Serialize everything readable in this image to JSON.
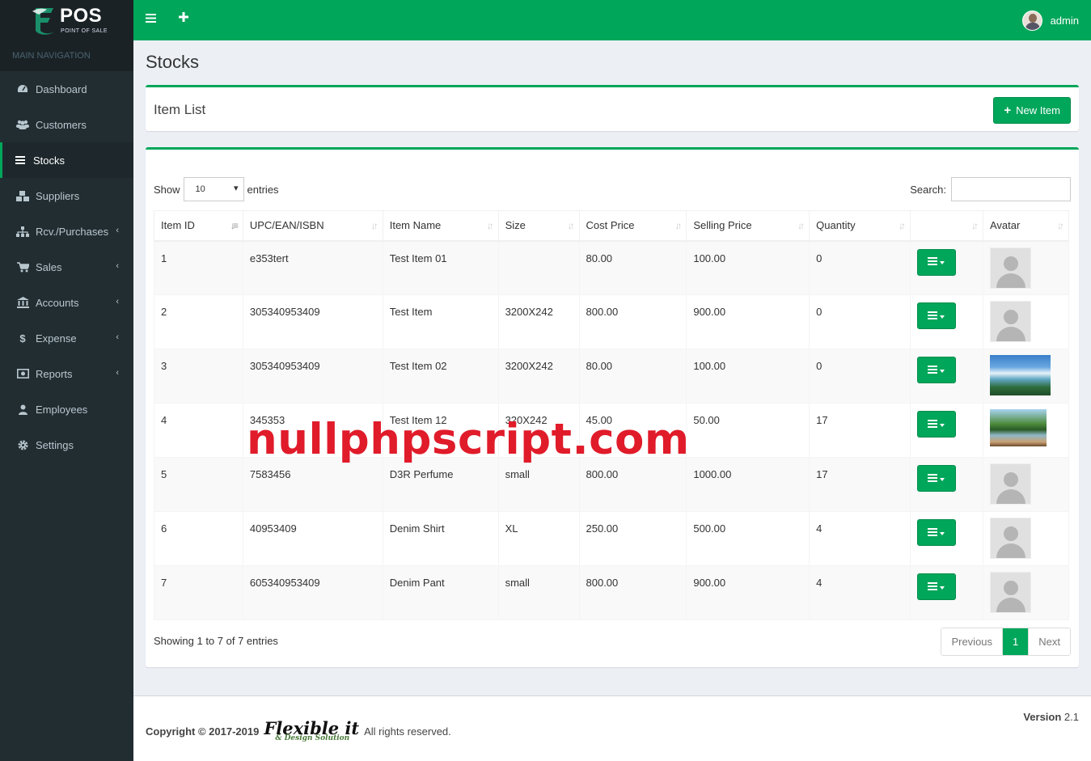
{
  "brand": {
    "name": "POS",
    "sub": "POINT OF SALE"
  },
  "sidebar": {
    "header": "MAIN NAVIGATION",
    "items": [
      {
        "label": "Dashboard",
        "icon": "dashboard-icon"
      },
      {
        "label": "Customers",
        "icon": "users-icon"
      },
      {
        "label": "Stocks",
        "icon": "list-icon"
      },
      {
        "label": "Suppliers",
        "icon": "cubes-icon"
      },
      {
        "label": "Rcv./Purchases",
        "icon": "sitemap-icon"
      },
      {
        "label": "Sales",
        "icon": "cart-icon"
      },
      {
        "label": "Accounts",
        "icon": "bank-icon"
      },
      {
        "label": "Expense",
        "icon": "dollar-icon"
      },
      {
        "label": "Reports",
        "icon": "report-icon"
      },
      {
        "label": "Employees",
        "icon": "user-icon"
      },
      {
        "label": "Settings",
        "icon": "gear-icon"
      }
    ]
  },
  "header": {
    "user": "admin"
  },
  "page": {
    "title": "Stocks"
  },
  "item_list": {
    "title": "Item List",
    "new_button": "New Item"
  },
  "table_controls": {
    "show": "Show",
    "length": "10",
    "entries": "entries",
    "search": "Search:"
  },
  "table": {
    "headers": [
      "Item ID",
      "UPC/EAN/ISBN",
      "Item Name",
      "Size",
      "Cost Price",
      "Selling Price",
      "Quantity",
      "",
      "Avatar"
    ],
    "rows": [
      {
        "id": "1",
        "upc": "e353tert",
        "name": "Test Item 01",
        "size": "",
        "cost": "80.00",
        "sell": "100.00",
        "qty": "0",
        "avatar": "placeholder"
      },
      {
        "id": "2",
        "upc": "305340953409",
        "name": "Test Item",
        "size": "3200X242",
        "cost": "800.00",
        "sell": "900.00",
        "qty": "0",
        "avatar": "placeholder"
      },
      {
        "id": "3",
        "upc": "305340953409",
        "name": "Test Item 02",
        "size": "3200X242",
        "cost": "80.00",
        "sell": "100.00",
        "qty": "0",
        "avatar": "waterfall-photo"
      },
      {
        "id": "4",
        "upc": "345353",
        "name": "Test Item 12",
        "size": "320X242",
        "cost": "45.00",
        "sell": "50.00",
        "qty": "17",
        "avatar": "lake-photo"
      },
      {
        "id": "5",
        "upc": "7583456",
        "name": "D3R Perfume",
        "size": "small",
        "cost": "800.00",
        "sell": "1000.00",
        "qty": "17",
        "avatar": "placeholder"
      },
      {
        "id": "6",
        "upc": "40953409",
        "name": "Denim Shirt",
        "size": "XL",
        "cost": "250.00",
        "sell": "500.00",
        "qty": "4",
        "avatar": "placeholder"
      },
      {
        "id": "7",
        "upc": "605340953409",
        "name": "Denim Pant",
        "size": "small",
        "cost": "800.00",
        "sell": "900.00",
        "qty": "4",
        "avatar": "placeholder"
      }
    ]
  },
  "footer_info": "Showing 1 to 7 of 7 entries",
  "pagination": {
    "previous": "Previous",
    "current": "1",
    "next": "Next"
  },
  "watermark": "nullphpscript.com",
  "footer": {
    "copyright": "Copyright © 2017-2019",
    "logo_text": "Flexible it",
    "logo_sub": "& Design Solution",
    "rights": "All rights reserved.",
    "version_label": "Version",
    "version": "2.1"
  },
  "colors": {
    "accent": "#00a65a",
    "sidebar": "#222d32",
    "watermark": "#e01b2a"
  }
}
